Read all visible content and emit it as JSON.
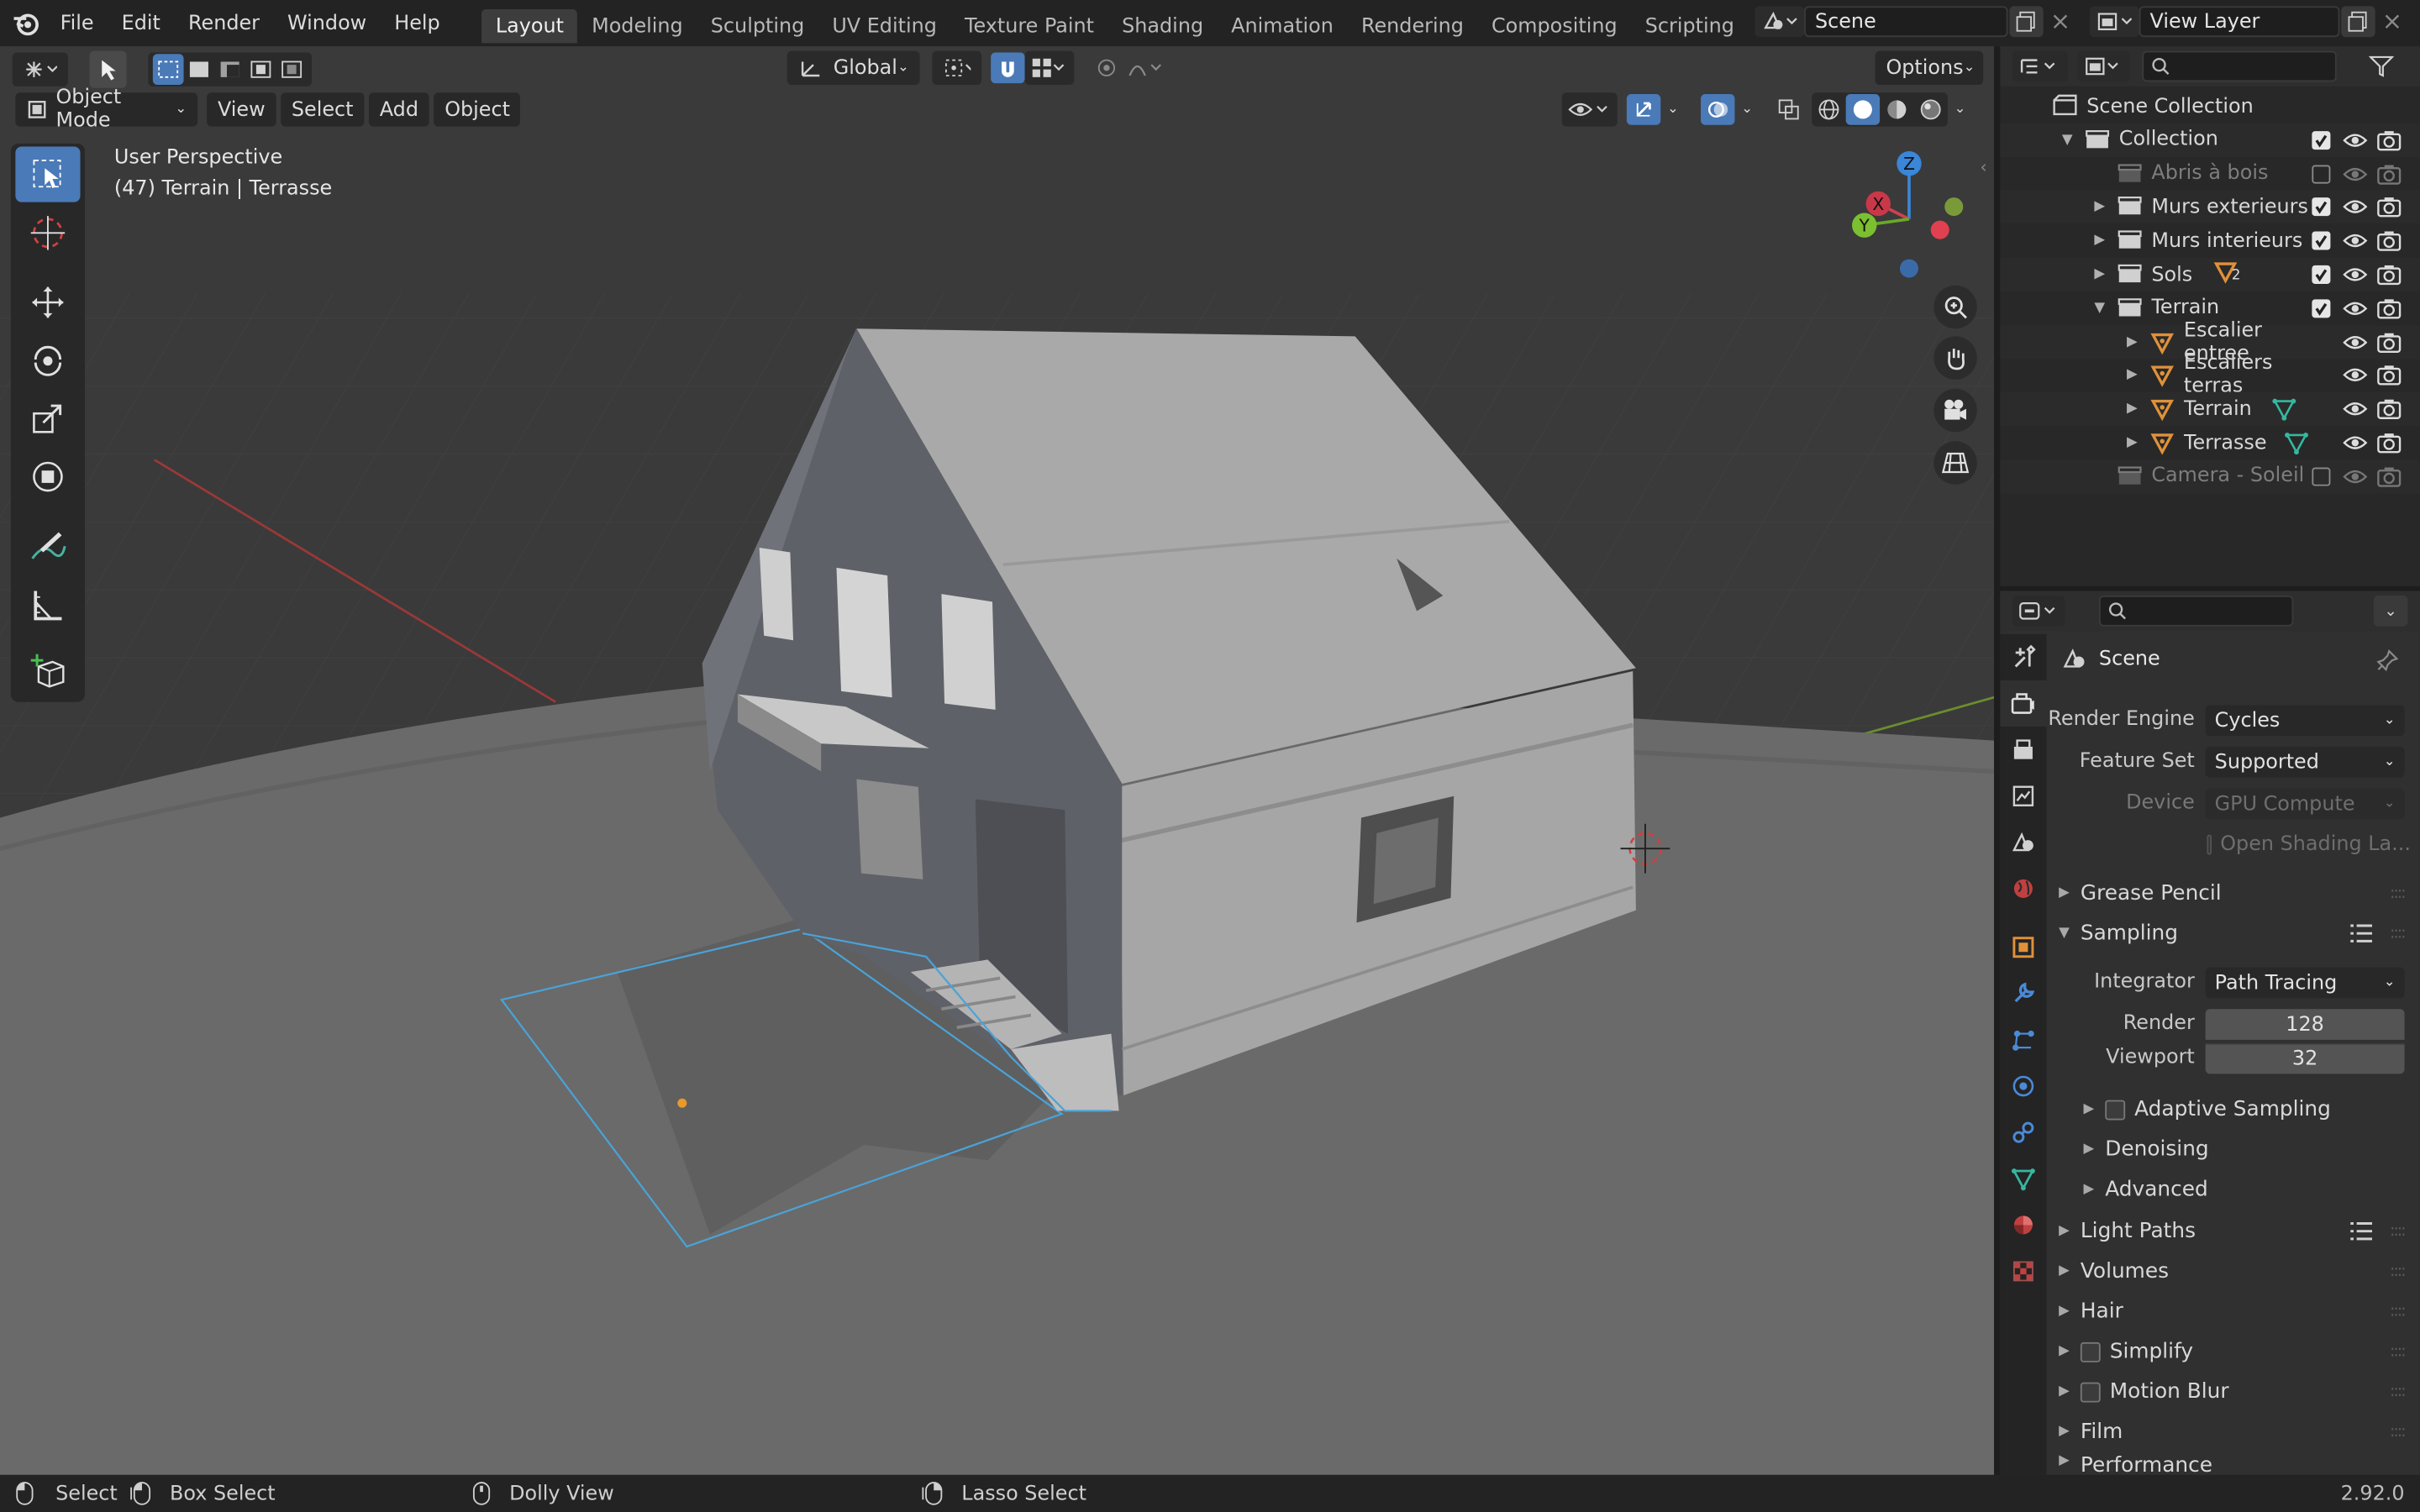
{
  "topbar": {
    "menus": [
      "File",
      "Edit",
      "Render",
      "Window",
      "Help"
    ],
    "workspaces": [
      "Layout",
      "Modeling",
      "Sculpting",
      "UV Editing",
      "Texture Paint",
      "Shading",
      "Animation",
      "Rendering",
      "Compositing",
      "Scripting"
    ],
    "active_workspace": "Layout",
    "scene_name": "Scene",
    "view_layer": "View Layer"
  },
  "viewport": {
    "transform_orientation": "Global",
    "options_label": "Options",
    "mode": "Object Mode",
    "header_menus": [
      "View",
      "Select",
      "Add",
      "Object"
    ],
    "overlay_line1": "User Perspective",
    "overlay_line2": "(47) Terrain | Terrasse",
    "gizmo": {
      "x": "X",
      "y": "Y",
      "z": "Z"
    }
  },
  "outliner": {
    "search_placeholder": "",
    "rows": [
      {
        "label": "Scene Collection",
        "level": 0,
        "type": "scene",
        "expand": "",
        "dim": false,
        "check": "",
        "eye": false,
        "extra": ""
      },
      {
        "label": "Collection",
        "level": 1,
        "type": "collection",
        "expand": "▼",
        "dim": false,
        "check": "on",
        "eye": true,
        "extra": ""
      },
      {
        "label": "Abris à bois",
        "level": 2,
        "type": "collection",
        "expand": "",
        "dim": true,
        "check": "off",
        "eye": true,
        "extra": ""
      },
      {
        "label": "Murs exterieurs",
        "level": 2,
        "type": "collection",
        "expand": "▶",
        "dim": false,
        "check": "on",
        "eye": true,
        "extra": ""
      },
      {
        "label": "Murs interieurs",
        "level": 2,
        "type": "collection",
        "expand": "▶",
        "dim": false,
        "check": "on",
        "eye": true,
        "extra": ""
      },
      {
        "label": "Sols",
        "level": 2,
        "type": "collection",
        "expand": "▶",
        "dim": false,
        "check": "on",
        "eye": true,
        "extra": "2"
      },
      {
        "label": "Terrain",
        "level": 2,
        "type": "collection",
        "expand": "▼",
        "dim": false,
        "check": "on",
        "eye": true,
        "extra": ""
      },
      {
        "label": "Escalier entree",
        "level": 3,
        "type": "mesh",
        "expand": "▶",
        "dim": false,
        "check": "",
        "eye": true,
        "extra": ""
      },
      {
        "label": "Escaliers terras",
        "level": 3,
        "type": "mesh",
        "expand": "▶",
        "dim": false,
        "check": "",
        "eye": true,
        "extra": ""
      },
      {
        "label": "Terrain",
        "level": 3,
        "type": "mesh",
        "expand": "▶",
        "dim": false,
        "check": "",
        "eye": true,
        "extra": "vgroup"
      },
      {
        "label": "Terrasse",
        "level": 3,
        "type": "mesh",
        "expand": "▶",
        "dim": false,
        "check": "",
        "eye": true,
        "extra": "vgroup"
      },
      {
        "label": "Camera - Soleil",
        "level": 2,
        "type": "collection",
        "expand": "",
        "dim": true,
        "check": "off",
        "eye": true,
        "extra": ""
      }
    ]
  },
  "properties": {
    "context_title": "Scene",
    "render_engine_label": "Render Engine",
    "render_engine": "Cycles",
    "feature_set_label": "Feature Set",
    "feature_set": "Supported",
    "device_label": "Device",
    "device": "GPU Compute",
    "open_shading": "Open Shading La...",
    "sections": {
      "grease_pencil": "Grease Pencil",
      "sampling": "Sampling",
      "light_paths": "Light Paths",
      "volumes": "Volumes",
      "hair": "Hair",
      "simplify": "Simplify",
      "motion_blur": "Motion Blur",
      "film": "Film",
      "performance": "Performance"
    },
    "integrator_label": "Integrator",
    "integrator": "Path Tracing",
    "render_samples_label": "Render",
    "render_samples": "128",
    "viewport_samples_label": "Viewport",
    "viewport_samples": "32",
    "subsections": {
      "adaptive": "Adaptive Sampling",
      "denoising": "Denoising",
      "advanced": "Advanced"
    }
  },
  "statusbar": {
    "select": "Select",
    "box_select": "Box Select",
    "dolly_view": "Dolly View",
    "lasso_select": "Lasso Select",
    "version": "2.92.0"
  },
  "colors": {
    "accent": "#4a7ab8",
    "mesh_orange": "#e0913a",
    "vgroup_teal": "#34b8a0"
  }
}
